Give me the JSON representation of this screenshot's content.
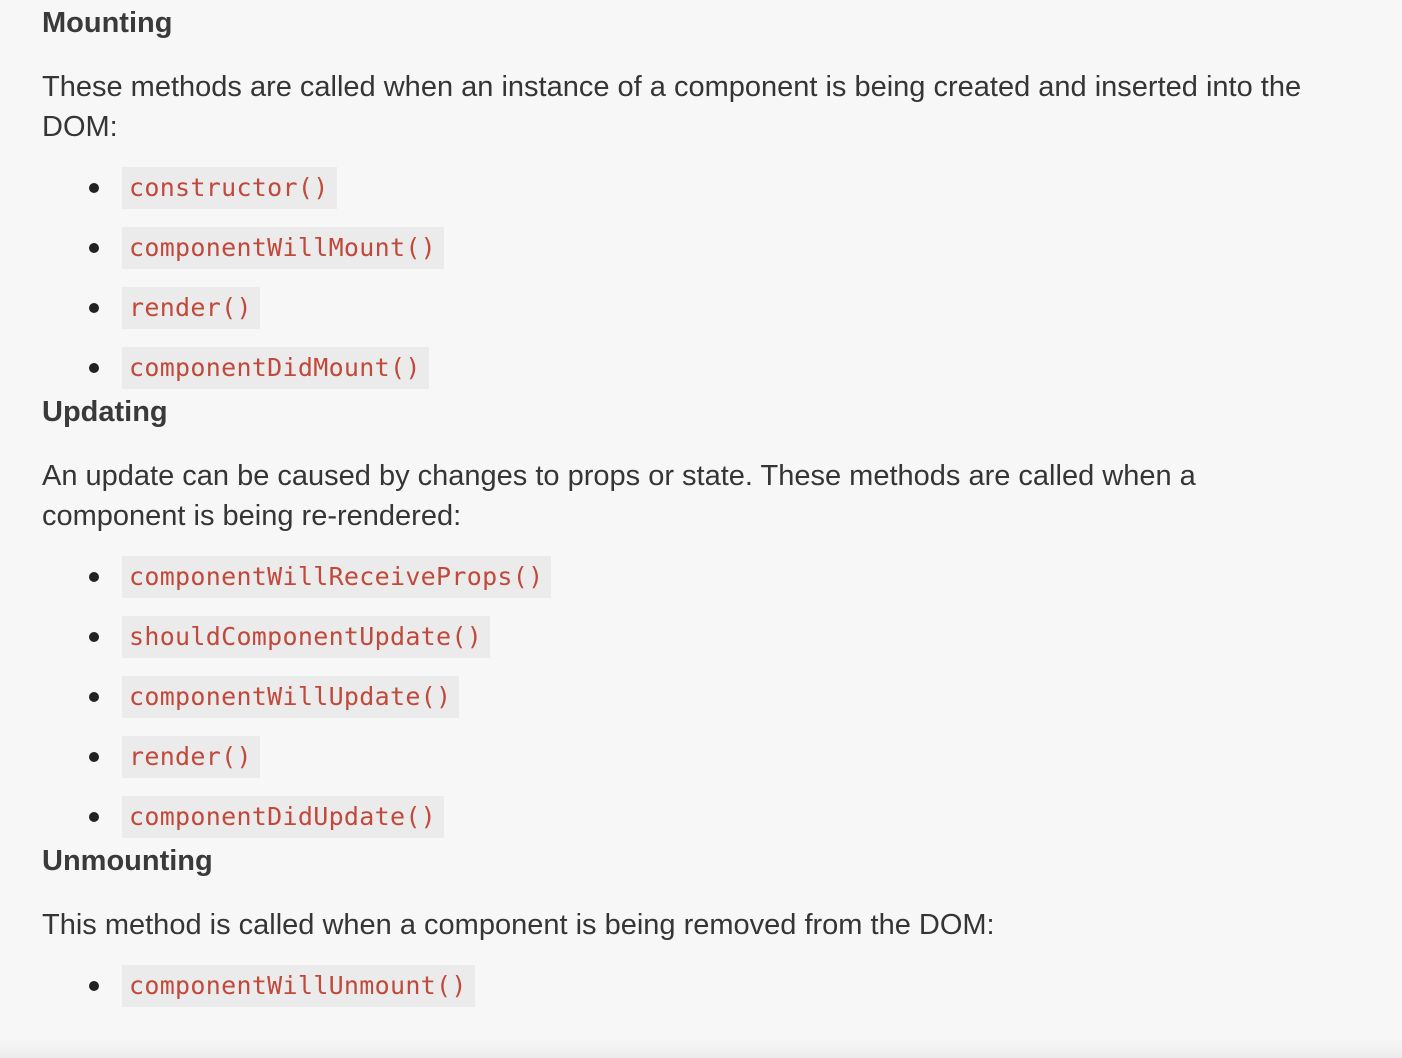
{
  "sections": [
    {
      "heading": "Mounting",
      "text": "These methods are called when an instance of a component is being created and inserted into the DOM:",
      "methods": [
        "constructor()",
        "componentWillMount()",
        "render()",
        "componentDidMount()"
      ]
    },
    {
      "heading": "Updating",
      "text": "An update can be caused by changes to props or state. These methods are called when a component is being re-rendered:",
      "methods": [
        "componentWillReceiveProps()",
        "shouldComponentUpdate()",
        "componentWillUpdate()",
        "render()",
        "componentDidUpdate()"
      ]
    },
    {
      "heading": "Unmounting",
      "text": "This method is called when a component is being removed from the DOM:",
      "methods": [
        "componentWillUnmount()"
      ]
    }
  ],
  "colors": {
    "background": "#f7f7f7",
    "text": "#333333",
    "code_text": "#c1493b",
    "code_background": "#ebebeb"
  }
}
